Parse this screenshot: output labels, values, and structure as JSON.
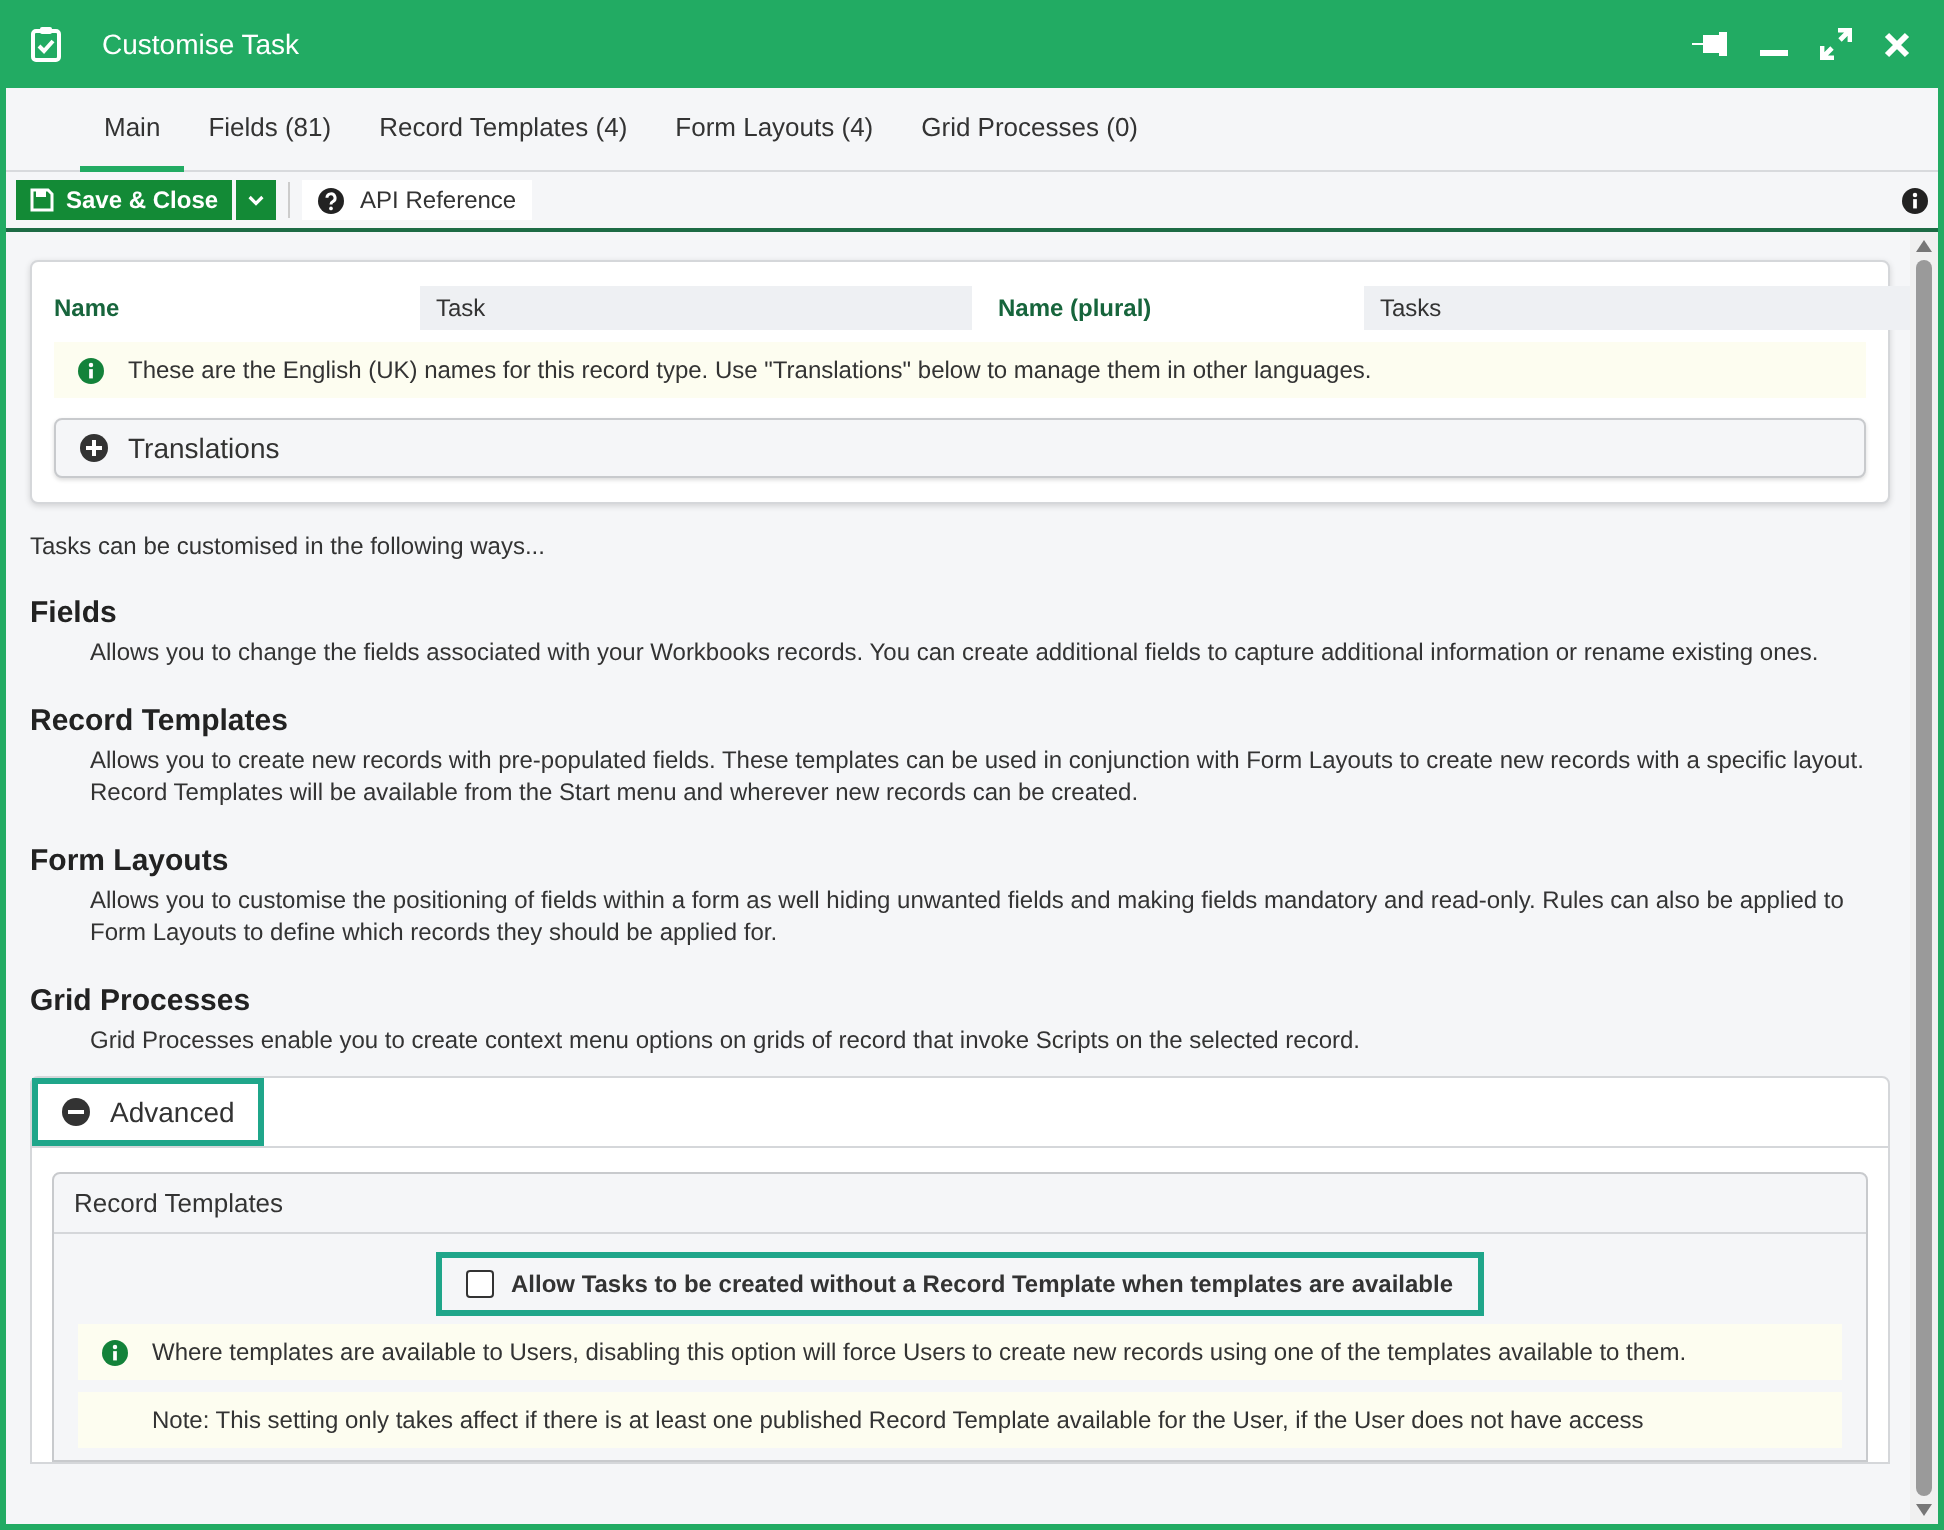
{
  "window": {
    "title": "Customise Task"
  },
  "tabs": [
    {
      "label": "Main",
      "selected": true
    },
    {
      "label": "Fields (81)",
      "selected": false
    },
    {
      "label": "Record Templates (4)",
      "selected": false
    },
    {
      "label": "Form Layouts (4)",
      "selected": false
    },
    {
      "label": "Grid Processes (0)",
      "selected": false
    }
  ],
  "toolbar": {
    "save_button": "Save & Close",
    "api_reference": "API Reference"
  },
  "names": {
    "name_label": "Name",
    "name_value": "Task",
    "plural_label": "Name (plural)",
    "plural_value": "Tasks",
    "info": "These are the English (UK) names for this record type. Use \"Translations\" below to manage them in other languages.",
    "translations": {
      "label": "Translations",
      "expanded": false
    }
  },
  "intro": "Tasks can be customised in the following ways...",
  "sections": [
    {
      "heading": "Fields",
      "text": "Allows you to change the fields associated with your Workbooks records. You can create additional fields to capture additional information or rename existing ones."
    },
    {
      "heading": "Record Templates",
      "text": "Allows you to create new records with pre-populated fields. These templates can be used in conjunction with Form Layouts to create new records with a specific layout. Record Templates will be available from the Start menu and wherever new records can be created."
    },
    {
      "heading": "Form Layouts",
      "text": "Allows you to customise the positioning of fields within a form as well hiding unwanted fields and making fields mandatory and read-only. Rules can also be applied to Form Layouts to define which records they should be applied for."
    },
    {
      "heading": "Grid Processes",
      "text": "Grid Processes enable you to create context menu options on grids of record that invoke Scripts on the selected record."
    }
  ],
  "advanced": {
    "label": "Advanced",
    "expanded": true,
    "highlighted": true,
    "panel_title": "Record Templates",
    "option": {
      "label": "Allow Tasks to be created without a Record Template when templates are available",
      "checked": false,
      "highlighted": true
    },
    "info": "Where templates are available to Users, disabling this option will force Users to create new records using one of the templates available to them.",
    "note": "Note: This setting only takes affect if there is at least one published Record Template available for the User, if the User does not have access"
  }
}
